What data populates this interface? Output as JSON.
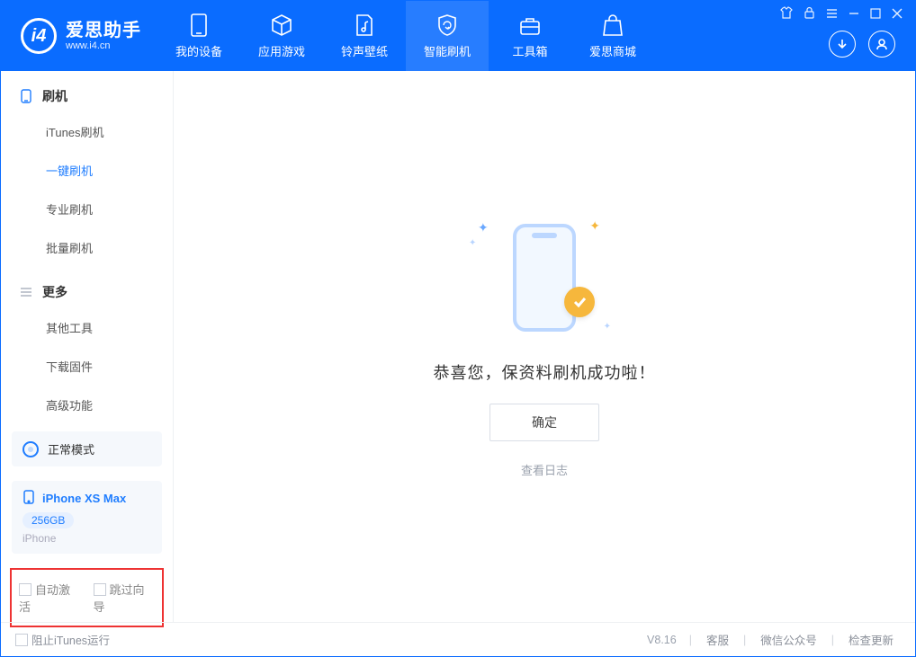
{
  "app": {
    "name_cn": "爱思助手",
    "name_en": "www.i4.cn"
  },
  "topnav": {
    "items": [
      {
        "label": "我的设备"
      },
      {
        "label": "应用游戏"
      },
      {
        "label": "铃声壁纸"
      },
      {
        "label": "智能刷机"
      },
      {
        "label": "工具箱"
      },
      {
        "label": "爱思商城"
      }
    ]
  },
  "sidebar": {
    "section1_title": "刷机",
    "section1": [
      {
        "label": "iTunes刷机"
      },
      {
        "label": "一键刷机"
      },
      {
        "label": "专业刷机"
      },
      {
        "label": "批量刷机"
      }
    ],
    "section2_title": "更多",
    "section2": [
      {
        "label": "其他工具"
      },
      {
        "label": "下载固件"
      },
      {
        "label": "高级功能"
      }
    ],
    "mode_label": "正常模式",
    "device": {
      "name": "iPhone XS Max",
      "storage": "256GB",
      "type": "iPhone"
    },
    "checks": {
      "auto_activate": "自动激活",
      "skip_guide": "跳过向导"
    }
  },
  "main": {
    "message": "恭喜您，保资料刷机成功啦！",
    "ok_label": "确定",
    "log_link": "查看日志"
  },
  "bottombar": {
    "block_itunes": "阻止iTunes运行",
    "version": "V8.16",
    "links": {
      "service": "客服",
      "wechat": "微信公众号",
      "update": "检查更新"
    }
  }
}
